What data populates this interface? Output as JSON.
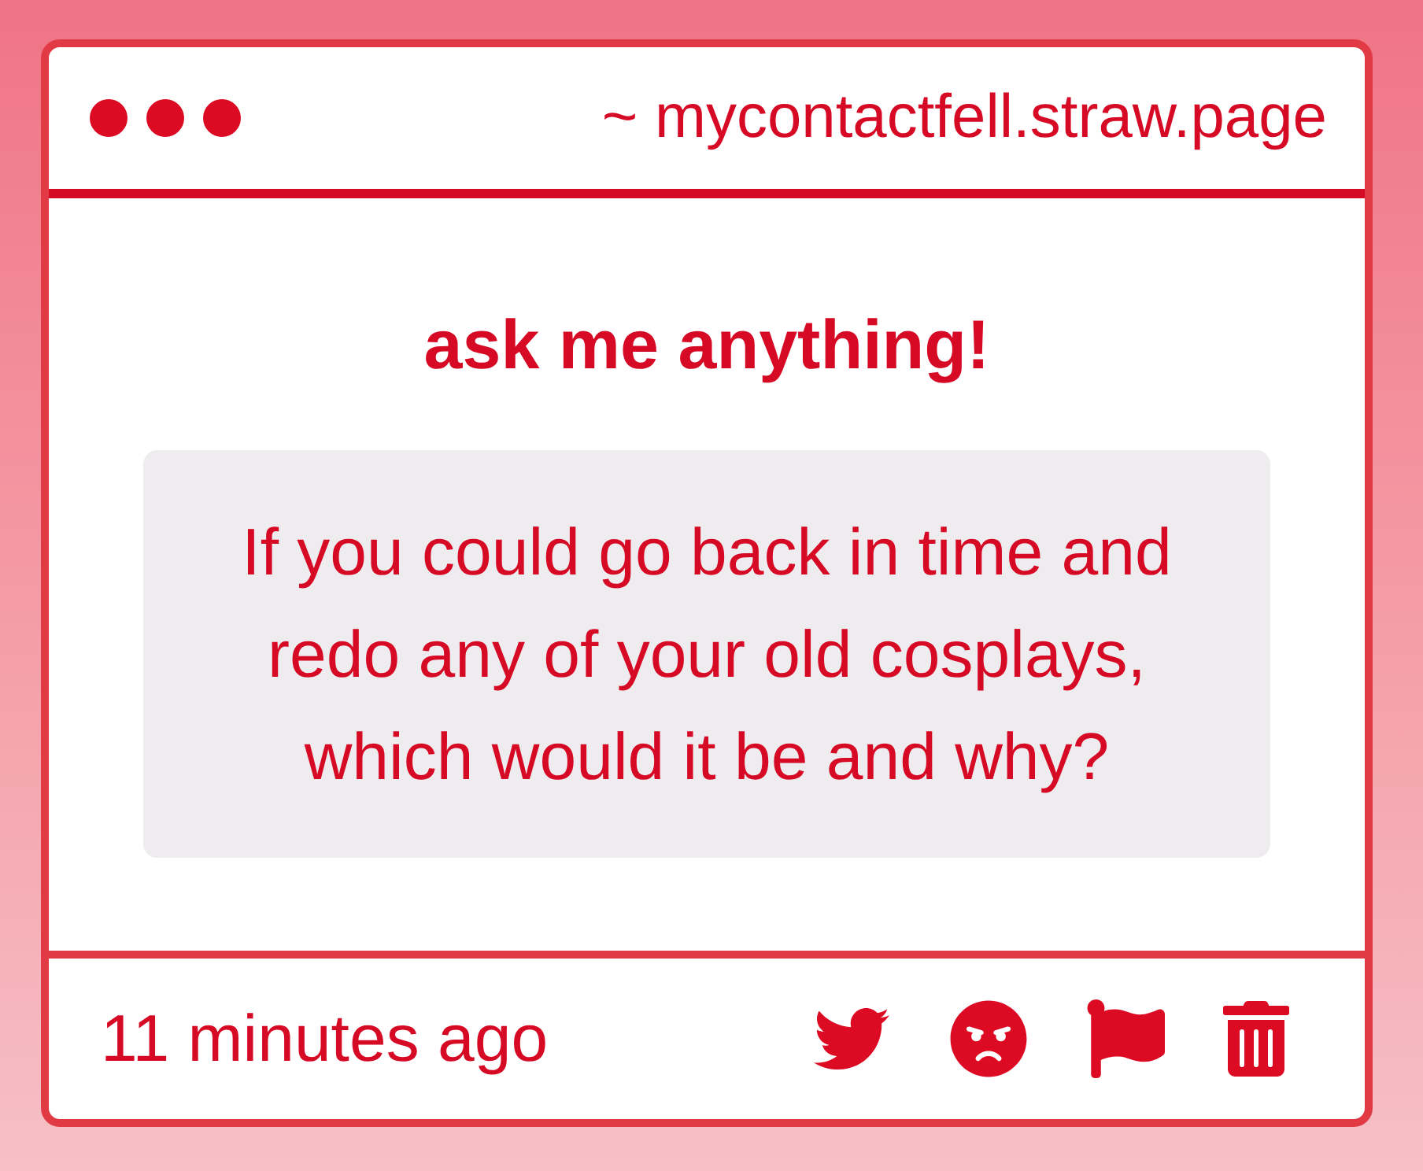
{
  "window": {
    "address": "~ mycontactfell.straw.page"
  },
  "heading": "ask me anything!",
  "question": "If you could go back in time and redo any of your old cosplays, which would it be and why?",
  "footer": {
    "time": "11 minutes ago"
  }
}
